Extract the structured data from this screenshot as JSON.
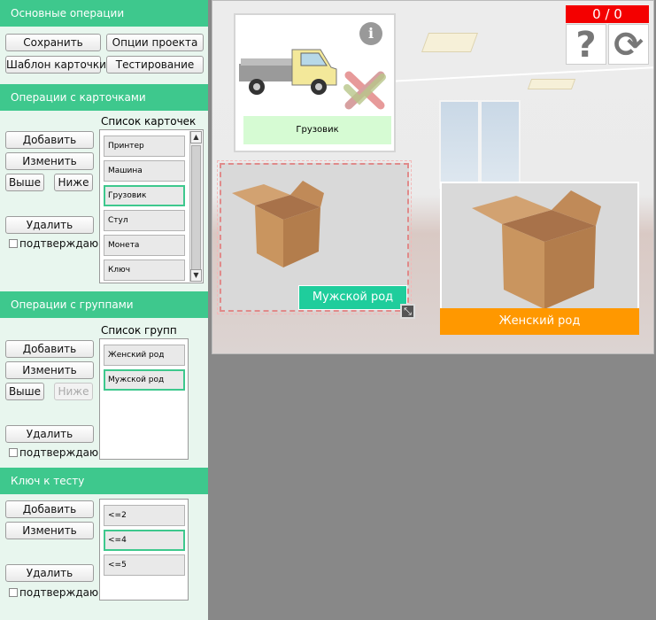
{
  "sections": {
    "basic": "Основные операции",
    "cards": "Операции с карточками",
    "groups": "Операции с группами",
    "key": "Ключ к тесту"
  },
  "basic_ops": {
    "save": "Сохранить",
    "project_options": "Опции проекта",
    "card_template": "Шаблон карточки",
    "testing": "Тестирование"
  },
  "card_ops": {
    "add": "Добавить",
    "edit": "Изменить",
    "up": "Выше",
    "down": "Ниже",
    "delete": "Удалить",
    "confirm": "подтверждаю",
    "list_title": "Список карточек",
    "items": [
      "Принтер",
      "Машина",
      "Грузовик",
      "Стул",
      "Монета",
      "Ключ"
    ],
    "selected_index": 2
  },
  "group_ops": {
    "add": "Добавить",
    "edit": "Изменить",
    "up": "Выше",
    "down": "Ниже",
    "delete": "Удалить",
    "confirm": "подтверждаю",
    "list_title": "Список групп",
    "items": [
      "Женский род",
      "Мужской род"
    ],
    "selected_index": 1
  },
  "key_ops": {
    "add": "Добавить",
    "edit": "Изменить",
    "delete": "Удалить",
    "confirm": "подтверждаю",
    "items": [
      "<=2",
      "<=4",
      "<=5"
    ],
    "selected_index": 1
  },
  "stage": {
    "score": "0 / 0",
    "help_icon": "?",
    "restart_icon": "⟳",
    "card_label": "Грузовик",
    "info_icon": "i",
    "groups": [
      {
        "label": "Мужской род",
        "color": "#1fcd9c"
      },
      {
        "label": "Женский род",
        "color": "#ff9800"
      }
    ],
    "resize_icon": "⤡"
  }
}
